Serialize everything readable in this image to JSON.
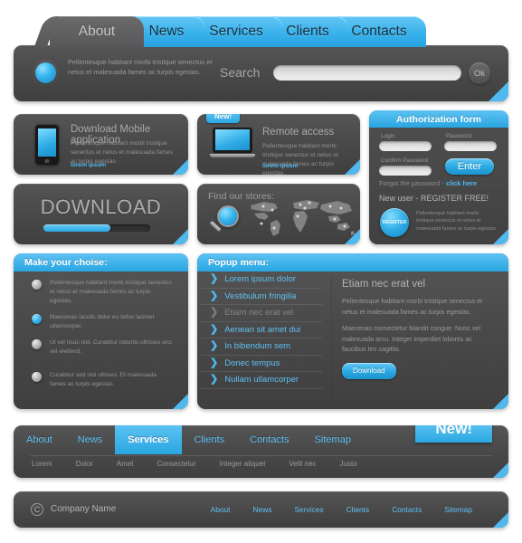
{
  "header_tabs": [
    {
      "label": "About",
      "active": true
    },
    {
      "label": "News",
      "active": false
    },
    {
      "label": "Services",
      "active": false
    },
    {
      "label": "Clients",
      "active": false
    },
    {
      "label": "Contacts",
      "active": false
    }
  ],
  "header": {
    "intro_text": "Pellentesque habitant morbi tristique senectus et netus et malesuada fames ac turpis egestas.",
    "search_label": "Search",
    "search_value": "",
    "search_placeholder": "",
    "ok_label": "Ok"
  },
  "mobile_box": {
    "title": "Download Mobile application",
    "body": "Pellentesque habitant morbi tristique senectus et netus et malesuada fames ac turpis egestas.",
    "link": "lorem ipsum"
  },
  "remote_box": {
    "badge": "New!",
    "title": "Remote access",
    "body": "Pellentesque habitant morbi tristique senectus et netus et malesuada fames ac turpis egestas.",
    "link": "lorem ipsum"
  },
  "auth_form": {
    "title": "Authorization form",
    "login_label": "Login",
    "login_value": "",
    "password_label": "Password",
    "password_value": "",
    "confirm_label": "Confirm Password",
    "confirm_value": "",
    "enter_label": "Enter",
    "forgot_text": "Forgot the password - ",
    "forgot_link": "click here",
    "new_user_text": "New user - REGISTER FREE!",
    "register_label": "REGISTER",
    "register_body": "Pellentesque habitant morbi tristique senectus et netus et malesuada fames ac turpis egestas."
  },
  "download_box": {
    "label": "DOWNLOAD",
    "progress_percent": 63
  },
  "stores_box": {
    "title": "Find our stores:"
  },
  "choice_panel": {
    "title": "Make your choise:",
    "options": [
      {
        "text": "Pellentesque habitant morbi tristique senectus et netus et malesuada fames ac turpis egestas.",
        "selected": false
      },
      {
        "text": "Maecenas iaculis dolor eu tellus laoreet ullamcorper.",
        "selected": true
      },
      {
        "text": "Ut vel risus nisl. Curabitur lobortis ultricies orci vel eleifend.",
        "selected": false
      },
      {
        "text": "Curabitur sed nisi ultrices. Et malesuada fames ac turpis egestas.",
        "selected": false
      }
    ]
  },
  "popup_panel": {
    "title": "Popup menu:",
    "items": [
      {
        "label": "Lorem ipsum dolor",
        "disabled": false
      },
      {
        "label": "Vestibulum fringilla",
        "disabled": false
      },
      {
        "label": "Etiam nec erat vel",
        "disabled": true
      },
      {
        "label": "Aenean sit amet dui",
        "disabled": false
      },
      {
        "label": "In bibendum sem",
        "disabled": false
      },
      {
        "label": "Donec tempus",
        "disabled": false
      },
      {
        "label": "Nullam ullamcorper",
        "disabled": false
      }
    ],
    "content_title": "Etiam nec erat vel",
    "content_p1": "Pellentesque habitant morbi tristique senectus et netus et malesuada fames ac turpis egestas.",
    "content_p2": "Maecenas consectetur blandit congue. Nunc vel malesuada arcu. Integer imperdiet lobortis ac faucibus leo sagittis.",
    "download_label": "Download"
  },
  "secondary_nav": {
    "links": [
      {
        "label": "About",
        "active": false
      },
      {
        "label": "News",
        "active": false
      },
      {
        "label": "Services",
        "active": true
      },
      {
        "label": "Clients",
        "active": false
      },
      {
        "label": "Contacts",
        "active": false
      },
      {
        "label": "Sitemap",
        "active": false
      }
    ],
    "sub_links": [
      "Lorem",
      "Dolor",
      "Amet",
      "Consectetur",
      "Integer aliquet",
      "Velit nec",
      "Justo"
    ],
    "banner": "New!"
  },
  "footer": {
    "copyright_symbol": "C",
    "company": "Company Name",
    "links": [
      "About",
      "News",
      "Services",
      "Clients",
      "Contacts",
      "Sitemap"
    ]
  },
  "colors": {
    "accent_blue": "#2ba8e2",
    "accent_blue_light": "#5fc0f1",
    "panel_dark": "#4a4a4b",
    "text_grey": "#9a9a9c"
  }
}
